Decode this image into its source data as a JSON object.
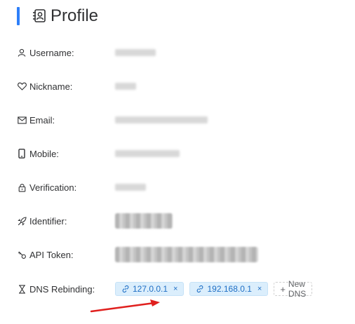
{
  "header": {
    "title": "Profile"
  },
  "fields": [
    {
      "key": "username",
      "label": "Username:",
      "icon": "user-icon",
      "value": ""
    },
    {
      "key": "nickname",
      "label": "Nickname:",
      "icon": "heart-icon",
      "value": ""
    },
    {
      "key": "email",
      "label": "Email:",
      "icon": "mail-icon",
      "value": ""
    },
    {
      "key": "mobile",
      "label": "Mobile:",
      "icon": "phone-icon",
      "value": ""
    },
    {
      "key": "verification",
      "label": "Verification:",
      "icon": "lock-icon",
      "value": ""
    },
    {
      "key": "identifier",
      "label": "Identifier:",
      "icon": "rocket-icon",
      "value": ""
    },
    {
      "key": "api_token",
      "label": "API Token:",
      "icon": "key-icon",
      "value": ""
    },
    {
      "key": "dns_rebinding",
      "label": "DNS Rebinding:",
      "icon": "hourglass-icon"
    }
  ],
  "dns_rebinding": {
    "tags": [
      {
        "label": "127.0.0.1"
      },
      {
        "label": "192.168.0.1"
      }
    ],
    "new_label": "New DNS",
    "close_symbol": "×",
    "plus_symbol": "+"
  },
  "colors": {
    "accent": "#2d7ff9",
    "tag_bg": "#dbeefc",
    "tag_text": "#1f6fc5",
    "annotation_arrow": "#e0201e"
  }
}
